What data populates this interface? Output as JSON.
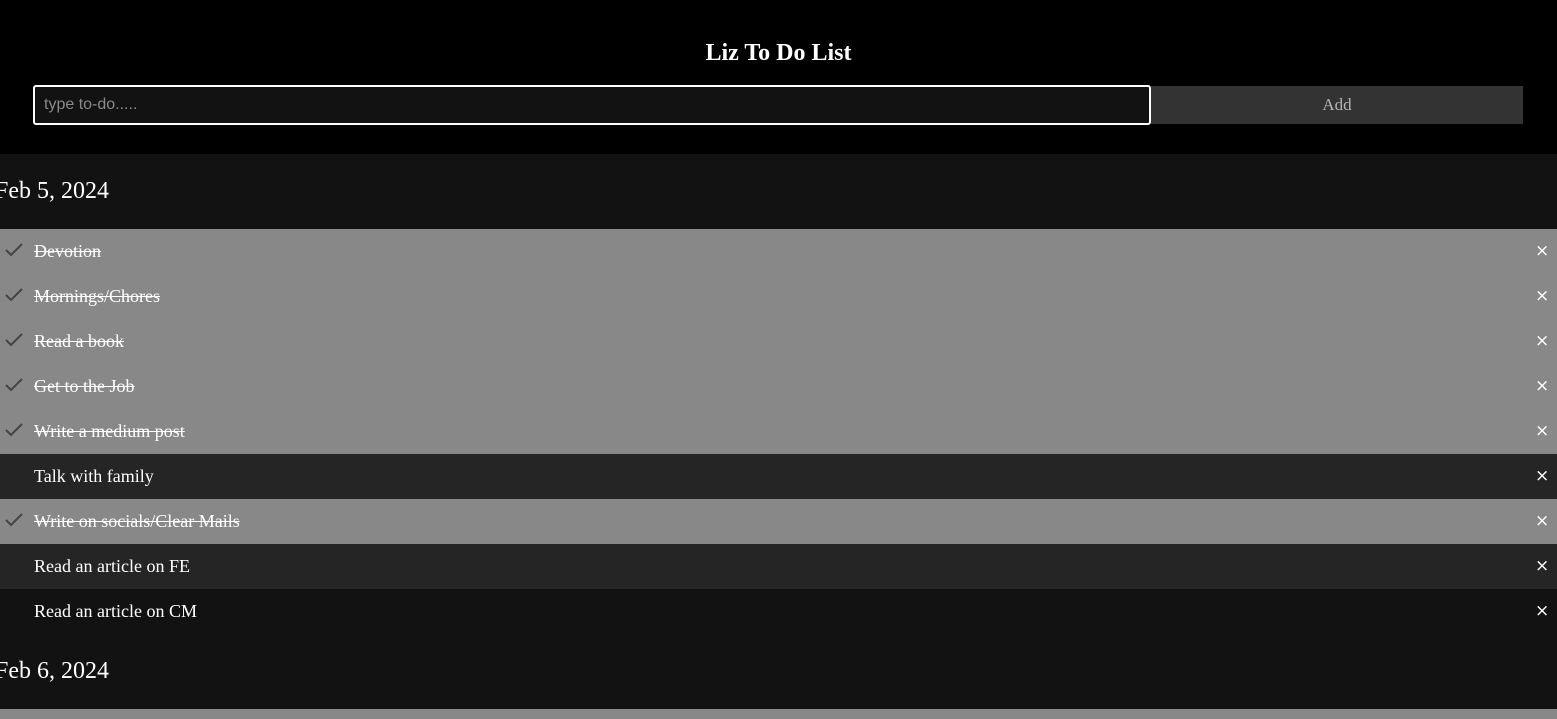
{
  "app": {
    "title": "Liz To Do List"
  },
  "form": {
    "input_value": "",
    "input_placeholder": "type to-do.....",
    "add_label": "Add"
  },
  "days": [
    {
      "date": "Feb 5, 2024",
      "items": [
        {
          "text": "Devotion",
          "checked": true
        },
        {
          "text": "Mornings/Chores",
          "checked": true
        },
        {
          "text": "Read a book",
          "checked": true
        },
        {
          "text": "Get to the Job",
          "checked": true
        },
        {
          "text": "Write a medium post",
          "checked": true
        },
        {
          "text": "Talk with family",
          "checked": false
        },
        {
          "text": "Write on socials/Clear Mails",
          "checked": true
        },
        {
          "text": "Read an article on FE",
          "checked": false
        },
        {
          "text": "Read an article on CM",
          "checked": false
        }
      ]
    },
    {
      "date": "Feb 6, 2024",
      "items": [
        {
          "text": "",
          "checked": true
        }
      ]
    }
  ],
  "icons": {
    "check": "check-icon",
    "close": "close-icon",
    "close_glyph": "×"
  },
  "colors": {
    "header_bg": "#000000",
    "page_bg": "#121212",
    "checked_bg": "#888888",
    "alt_row_bg": "#252525",
    "button_bg": "#333333"
  }
}
